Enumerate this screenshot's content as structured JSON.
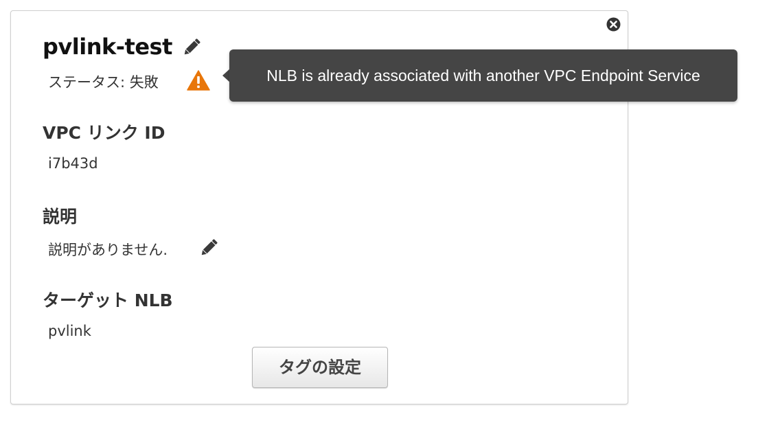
{
  "panel": {
    "title": "pvlink-test",
    "status_label": "ステータス: 失敗",
    "status_color": "#e8760a"
  },
  "tooltip": {
    "text": "NLB is already associated with another VPC Endpoint Service"
  },
  "fields": {
    "vpc_link_id": {
      "heading": "VPC リンク ID",
      "value": "i7b43d"
    },
    "description": {
      "heading": "説明",
      "value": "説明がありません."
    },
    "target_nlb": {
      "heading": "ターゲット NLB",
      "value": "pvlink"
    }
  },
  "actions": {
    "tag_settings_label": "タグの設定"
  },
  "icons": {
    "close": "close-icon",
    "edit": "pencil-icon",
    "warning": "warning-icon"
  }
}
